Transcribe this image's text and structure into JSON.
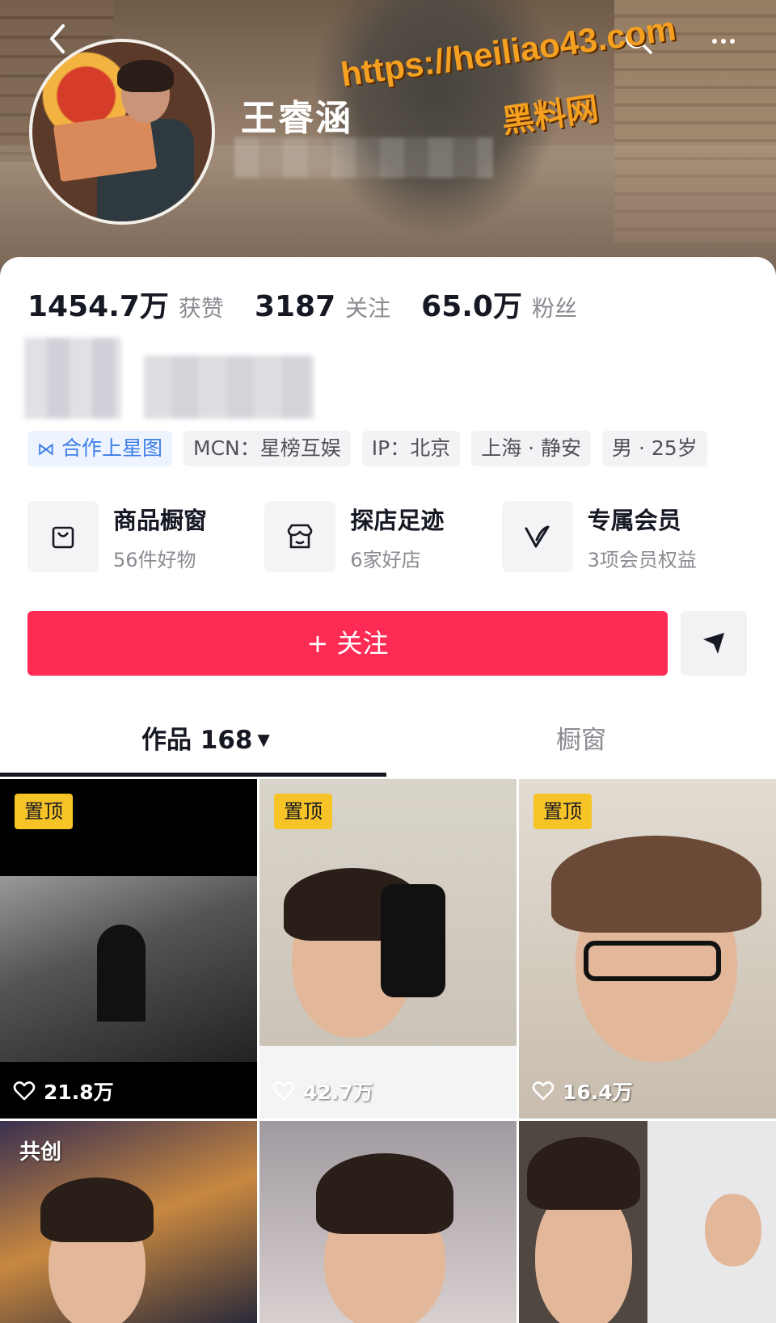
{
  "header": {
    "username": "王睿涵",
    "back_icon": "chevron-left-icon",
    "search_icon": "search-icon",
    "more_icon": "more-icon",
    "watermark_url": "https://heiliao43.com",
    "watermark_name": "黑料网"
  },
  "stats": [
    {
      "value": "1454.7万",
      "label": "获赞"
    },
    {
      "value": "3187",
      "label": "关注"
    },
    {
      "value": "65.0万",
      "label": "粉丝"
    }
  ],
  "tags": [
    "合作上星图",
    "MCN：星榜互娱",
    "IP：北京",
    "上海 · 静安",
    "男 · 25岁"
  ],
  "features": [
    {
      "title": "商品橱窗",
      "subtitle": "56件好物",
      "icon": "shopping-bag-icon"
    },
    {
      "title": "探店足迹",
      "subtitle": "6家好店",
      "icon": "store-icon"
    },
    {
      "title": "专属会员",
      "subtitle": "3项会员权益",
      "icon": "vip-icon"
    }
  ],
  "actions": {
    "follow_label": "+ 关注",
    "share_icon": "send-icon"
  },
  "tabs": {
    "works_label": "作品 168",
    "shop_label": "橱窗"
  },
  "videos": [
    {
      "badge": "置顶",
      "likes": "21.8万"
    },
    {
      "badge": "置顶",
      "likes": "42.7万"
    },
    {
      "badge": "置顶",
      "likes": "16.4万"
    },
    {
      "badge": "共创",
      "likes": ""
    },
    {
      "badge": "",
      "likes": ""
    },
    {
      "badge": "",
      "likes": ""
    }
  ],
  "colors": {
    "follow_button": "#fe2c55",
    "pin_badge": "#f7c428",
    "star_tag": "#3d7ee8"
  }
}
